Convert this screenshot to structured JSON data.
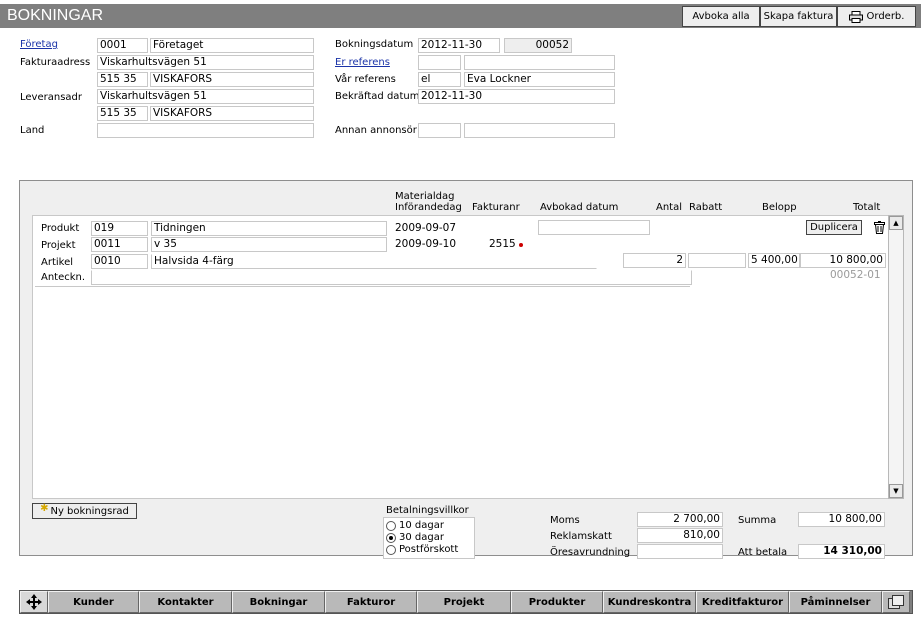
{
  "app": {
    "title": "BOKNINGAR"
  },
  "toolbar": {
    "cancel_all": "Avboka alla",
    "create_invoice": "Skapa faktura",
    "order": "Orderb."
  },
  "header": {
    "company_label": "Företag",
    "company_code": "0001",
    "company_name": "Företaget",
    "invoice_address_label": "Fakturaadress",
    "invoice_street": "Viskarhultsvägen 51",
    "invoice_zip": "515 35",
    "invoice_city": "VISKAFORS",
    "delivery_address_label": "Leveransadr",
    "delivery_street": "Viskarhultsvägen 51",
    "delivery_zip": "515 35",
    "delivery_city": "VISKAFORS",
    "country_label": "Land",
    "country": "",
    "booking_date_label": "Bokningsdatum",
    "booking_date": "2012-11-30",
    "booking_no": "00052",
    "your_ref_label": "Er referens",
    "your_ref_code": "",
    "your_ref_name": "",
    "our_ref_label": "Vår referens",
    "our_ref_code": "el",
    "our_ref_name": "Eva Lockner",
    "confirmed_date_label": "Bekräftad datum",
    "confirmed_date": "2012-11-30",
    "other_advertiser_label": "Annan annonsör",
    "other_adv_code": "",
    "other_adv_name": ""
  },
  "columns": {
    "material_day": "Materialdag",
    "insertion_day": "Införandedag",
    "invoice_no": "Fakturanr",
    "cancelled_date": "Avbokad datum",
    "qty": "Antal",
    "discount": "Rabatt",
    "amount": "Belopp",
    "total": "Totalt"
  },
  "row": {
    "product_label": "Produkt",
    "product_code": "019",
    "product_name": "Tidningen",
    "project_label": "Projekt",
    "project_code": "0011",
    "project_name": "v 35",
    "article_label": "Artikel",
    "article_code": "0010",
    "article_name": "Halvsida 4-färg",
    "note_label": "Anteckn.",
    "note": "",
    "material_date": "2009-09-07",
    "insertion_date": "2009-09-10",
    "invoice_no": "2515",
    "cancelled_date": "",
    "qty": "2",
    "discount": "",
    "amount": "5 400,00",
    "total": "10 800,00",
    "row_id": "00052-01",
    "duplicate": "Duplicera"
  },
  "new_row_button": "Ny bokningsrad",
  "payment_terms": {
    "label": "Betalningsvillkor",
    "options": [
      "10 dagar",
      "30 dagar",
      "Postförskott"
    ],
    "selected": "30 dagar"
  },
  "totals": {
    "vat_label": "Moms",
    "vat": "2 700,00",
    "ad_tax_label": "Reklamskatt",
    "ad_tax": "810,00",
    "rounding_label": "Öresavrundning",
    "rounding": "",
    "sum_label": "Summa",
    "sum": "10 800,00",
    "to_pay_label": "Att betala",
    "to_pay": "14 310,00"
  },
  "nav": [
    "Kunder",
    "Kontakter",
    "Bokningar",
    "Fakturor",
    "Projekt",
    "Produkter",
    "Kundreskontra",
    "Kreditfakturor",
    "Påminnelser"
  ],
  "icons": {
    "printer": "printer-icon",
    "trash": "trash-icon",
    "move": "move-icon",
    "window": "window-icon",
    "new": "star-icon"
  }
}
